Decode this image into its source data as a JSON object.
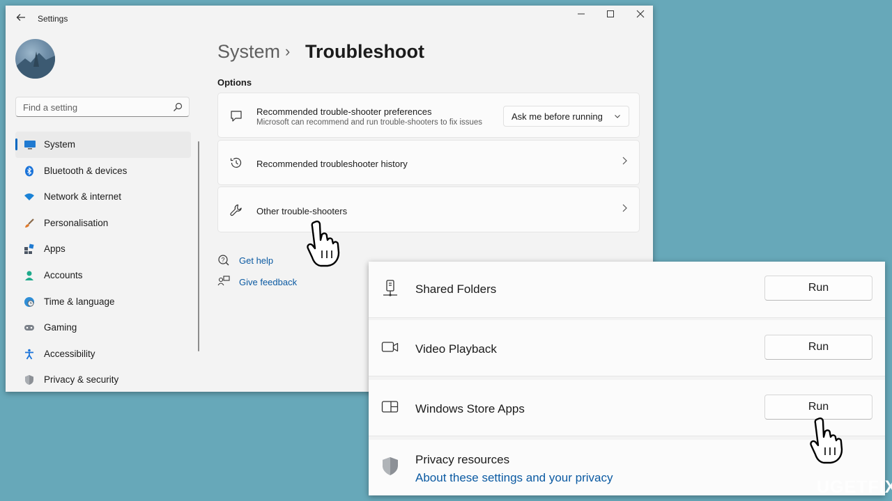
{
  "window": {
    "title": "Settings",
    "controls": [
      "minimize",
      "maximize",
      "close"
    ]
  },
  "search": {
    "placeholder": "Find a setting"
  },
  "sidebar": {
    "items": [
      {
        "label": "System",
        "icon": "monitor-icon",
        "active": true
      },
      {
        "label": "Bluetooth & devices",
        "icon": "bluetooth-icon"
      },
      {
        "label": "Network & internet",
        "icon": "wifi-icon"
      },
      {
        "label": "Personalisation",
        "icon": "brush-icon"
      },
      {
        "label": "Apps",
        "icon": "apps-icon"
      },
      {
        "label": "Accounts",
        "icon": "person-icon"
      },
      {
        "label": "Time & language",
        "icon": "globe-clock-icon"
      },
      {
        "label": "Gaming",
        "icon": "gamepad-icon"
      },
      {
        "label": "Accessibility",
        "icon": "accessibility-icon"
      },
      {
        "label": "Privacy & security",
        "icon": "shield-icon"
      }
    ]
  },
  "header": {
    "breadcrumb_parent": "System",
    "breadcrumb_separator": "›",
    "page_title": "Troubleshoot"
  },
  "options": {
    "section_label": "Options",
    "preferences": {
      "title": "Recommended trouble-shooter preferences",
      "subtitle": "Microsoft can recommend and run trouble-shooters to fix issues",
      "dropdown_value": "Ask me before running"
    },
    "history": {
      "title": "Recommended troubleshooter history"
    },
    "other": {
      "title": "Other trouble-shooters"
    }
  },
  "links": {
    "get_help": "Get help",
    "give_feedback": "Give feedback"
  },
  "troubleshooters": [
    {
      "label": "Shared Folders",
      "button": "Run",
      "icon": "shared-folder-icon"
    },
    {
      "label": "Video Playback",
      "button": "Run",
      "icon": "video-camera-icon"
    },
    {
      "label": "Windows Store Apps",
      "button": "Run",
      "icon": "store-apps-icon"
    }
  ],
  "privacy": {
    "title": "Privacy resources",
    "link": "About these settings and your privacy"
  },
  "watermark": "UGETFIX",
  "colors": {
    "background": "#67a8b9",
    "accent": "#0067c0",
    "link": "#0b5aa2"
  }
}
